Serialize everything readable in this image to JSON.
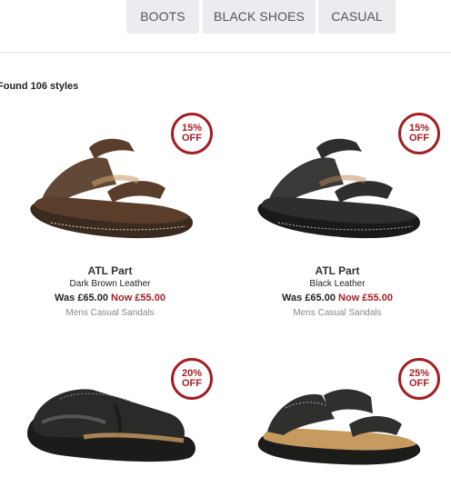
{
  "filters": [
    {
      "label": "BOOTS"
    },
    {
      "label": "BLACK SHOES"
    },
    {
      "label": "CASUAL"
    }
  ],
  "results": {
    "count_text": "Found 106 styles"
  },
  "products": [
    {
      "badge_percent": "15%",
      "badge_off": "OFF",
      "name": "ATL Part",
      "color": "Dark Brown Leather",
      "was": "Was £65.00",
      "now": "Now £55.00",
      "category": "Mens Casual Sandals",
      "shoe_color": "#5a3e2b"
    },
    {
      "badge_percent": "15%",
      "badge_off": "OFF",
      "name": "ATL Part",
      "color": "Black Leather",
      "was": "Was £65.00",
      "now": "Now £55.00",
      "category": "Mens Casual Sandals",
      "shoe_color": "#2e2e2c"
    },
    {
      "badge_percent": "20%",
      "badge_off": "OFF",
      "shoe_color": "#2a2a28"
    },
    {
      "badge_percent": "25%",
      "badge_off": "OFF",
      "shoe_color": "#2f2f2d"
    }
  ],
  "colors": {
    "accent": "#a31f24",
    "chip_bg": "#ebebf0"
  }
}
